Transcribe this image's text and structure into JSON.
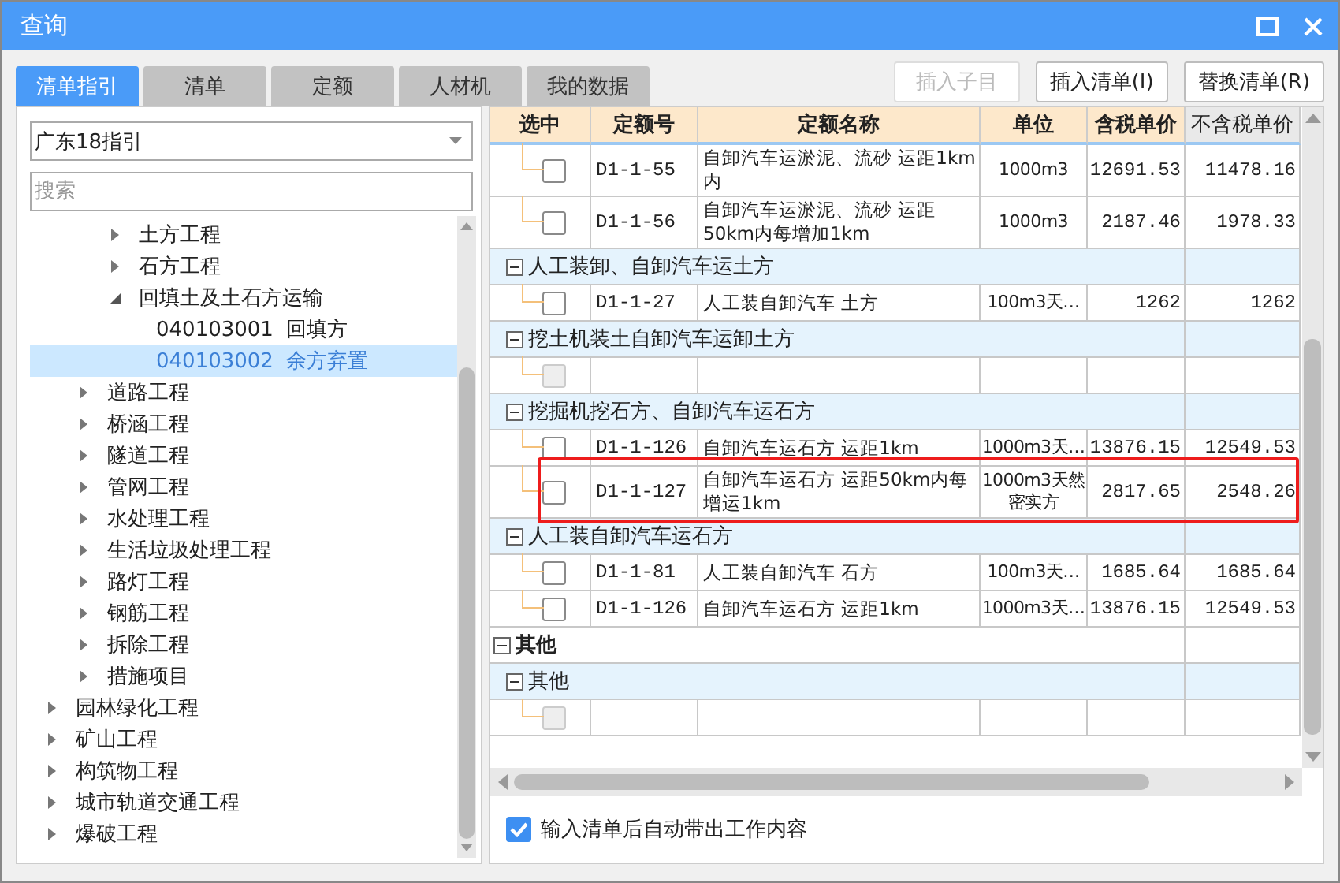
{
  "window": {
    "title": "查询"
  },
  "tabs": [
    {
      "label": "清单指引",
      "selected": true
    },
    {
      "label": "清单",
      "selected": false
    },
    {
      "label": "定额",
      "selected": false
    },
    {
      "label": "人材机",
      "selected": false
    },
    {
      "label": "我的数据",
      "selected": false
    }
  ],
  "buttons": [
    {
      "label": "插入子目",
      "disabled": true
    },
    {
      "label": "插入清单(I)",
      "disabled": false
    },
    {
      "label": "替换清单(R)",
      "disabled": false
    }
  ],
  "guide_select": {
    "value": "广东18指引"
  },
  "search": {
    "placeholder": "搜索"
  },
  "tree": [
    {
      "children": [
        {
          "children": [
            {
              "label": "土方工程",
              "expanded": false
            },
            {
              "label": "石方工程",
              "expanded": false
            },
            {
              "label": "回填土及土石方运输",
              "expanded": true,
              "children": [
                {
                  "code": "040103001",
                  "label": "回填方",
                  "selected": false
                },
                {
                  "code": "040103002",
                  "label": "余方弃置",
                  "selected": true
                }
              ]
            }
          ]
        },
        {
          "label": "道路工程",
          "expanded": false
        },
        {
          "label": "桥涵工程",
          "expanded": false
        },
        {
          "label": "隧道工程",
          "expanded": false
        },
        {
          "label": "管网工程",
          "expanded": false
        },
        {
          "label": "水处理工程",
          "expanded": false
        },
        {
          "label": "生活垃圾处理工程",
          "expanded": false
        },
        {
          "label": "路灯工程",
          "expanded": false
        },
        {
          "label": "钢筋工程",
          "expanded": false
        },
        {
          "label": "拆除工程",
          "expanded": false
        },
        {
          "label": "措施项目",
          "expanded": false
        }
      ]
    },
    {
      "label": "园林绿化工程",
      "expanded": false
    },
    {
      "label": "矿山工程",
      "expanded": false
    },
    {
      "label": "构筑物工程",
      "expanded": false
    },
    {
      "label": "城市轨道交通工程",
      "expanded": false
    },
    {
      "label": "爆破工程",
      "expanded": false
    }
  ],
  "table": {
    "columns": [
      {
        "label": "选中",
        "highlighted": true
      },
      {
        "label": "定额号",
        "highlighted": true
      },
      {
        "label": "定额名称",
        "highlighted": true
      },
      {
        "label": "单位",
        "highlighted": true
      },
      {
        "label": "含税单价",
        "highlighted": true
      },
      {
        "label": "不含税单价",
        "highlighted": false
      }
    ],
    "rows": [
      {
        "kind": "item",
        "checked": false,
        "disabled": false,
        "marked": false,
        "code": "D1-1-55",
        "name": "自卸汽车运淤泥、流砂 运距1km内",
        "unit": "1000m3",
        "price_tax": "12691.53",
        "price": "11478.16"
      },
      {
        "kind": "item",
        "checked": false,
        "disabled": false,
        "marked": false,
        "code": "D1-1-56",
        "name": "自卸汽车运淤泥、流砂 运距50km内每增加1km",
        "unit": "1000m3",
        "price_tax": "2187.46",
        "price": "1978.33"
      },
      {
        "kind": "group",
        "expanded": true,
        "label": "人工装卸、自卸汽车运土方"
      },
      {
        "kind": "item",
        "checked": false,
        "disabled": false,
        "marked": false,
        "code": "D1-1-27",
        "name": "人工装自卸汽车 土方",
        "unit": "100m3天…",
        "price_tax": "1262",
        "price": "1262"
      },
      {
        "kind": "group",
        "expanded": true,
        "label": "挖土机装土自卸汽车运卸土方"
      },
      {
        "kind": "item",
        "checked": false,
        "disabled": true,
        "marked": false
      },
      {
        "kind": "group",
        "expanded": true,
        "label": "挖掘机挖石方、自卸汽车运石方"
      },
      {
        "kind": "item",
        "checked": false,
        "disabled": false,
        "marked": false,
        "code": "D1-1-126",
        "name": "自卸汽车运石方 运距1km",
        "unit": "1000m3天…",
        "price_tax": "13876.15",
        "price": "12549.53"
      },
      {
        "kind": "item",
        "checked": false,
        "disabled": false,
        "marked": true,
        "code": "D1-1-127",
        "name": "自卸汽车运石方 运距50km内每增运1km",
        "unit": "1000m3天然密实方",
        "price_tax": "2817.65",
        "price": "2548.26"
      },
      {
        "kind": "group",
        "expanded": true,
        "label": "人工装自卸汽车运石方"
      },
      {
        "kind": "item",
        "checked": false,
        "disabled": false,
        "marked": false,
        "code": "D1-1-81",
        "name": "人工装自卸汽车 石方",
        "unit": "100m3天…",
        "price_tax": "1685.64",
        "price": "1685.64"
      },
      {
        "kind": "item",
        "checked": false,
        "disabled": false,
        "marked": false,
        "code": "D1-1-126",
        "name": "自卸汽车运石方 运距1km",
        "unit": "1000m3天…",
        "price_tax": "13876.15",
        "price": "12549.53"
      },
      {
        "kind": "category",
        "expanded": true,
        "label": "其他"
      },
      {
        "kind": "group",
        "expanded": true,
        "label": "其他"
      },
      {
        "kind": "item",
        "checked": false,
        "disabled": true,
        "marked": false
      }
    ]
  },
  "auto_option": {
    "label": "输入清单后自动带出工作内容",
    "checked": true
  }
}
